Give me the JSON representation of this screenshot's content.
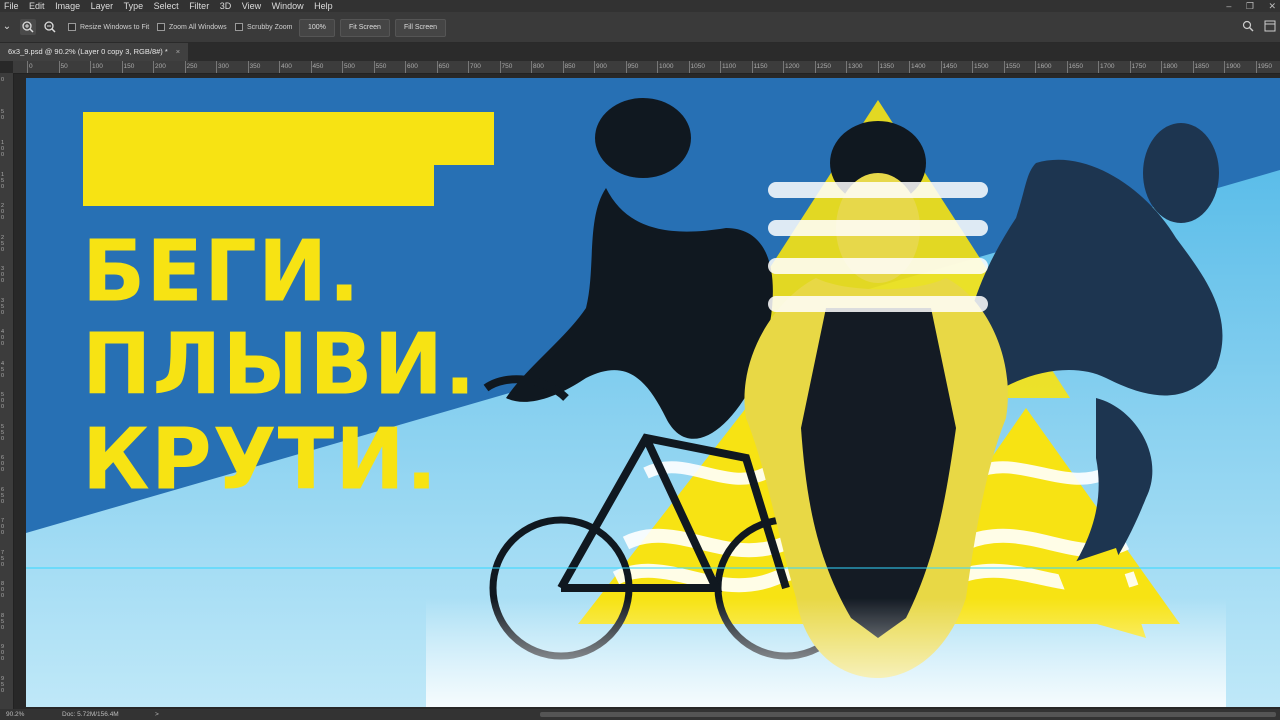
{
  "menu": [
    "File",
    "Edit",
    "Image",
    "Layer",
    "Type",
    "Select",
    "Filter",
    "3D",
    "View",
    "Window",
    "Help"
  ],
  "options": {
    "resize_windows": "Resize Windows to Fit",
    "zoom_all": "Zoom All Windows",
    "scrubby": "Scrubby Zoom",
    "zoom_value": "100%",
    "fit_screen": "Fit Screen",
    "fill_screen": "Fill Screen"
  },
  "tab": {
    "title": "6x3_9.psd @ 90.2% (Layer 0 copy 3, RGB/8#) *",
    "close": "×"
  },
  "ruler_top": [
    "0",
    "50",
    "100",
    "150",
    "200",
    "250",
    "300",
    "350",
    "400",
    "450",
    "500",
    "550",
    "600",
    "650",
    "700",
    "750",
    "800",
    "850",
    "900",
    "950",
    "1000",
    "1050",
    "1100",
    "1150",
    "1200",
    "1250",
    "1300",
    "1350",
    "1400",
    "1450",
    "1500",
    "1550",
    "1600",
    "1650",
    "1700",
    "1750",
    "1800",
    "1850",
    "1900",
    "1950"
  ],
  "ruler_left": [
    "0",
    "50",
    "100",
    "150",
    "200",
    "250",
    "300",
    "350",
    "400",
    "450",
    "500",
    "550",
    "600",
    "650",
    "700",
    "750",
    "800",
    "850",
    "900",
    "950"
  ],
  "artwork": {
    "line1": "БЕГИ.",
    "line2": "ПЛЫВИ.",
    "line3": "КРУТИ."
  },
  "colors": {
    "yellow": "#f7e313",
    "blue_dark": "#2770b4",
    "blue_light": "#6ec9ef",
    "guide": "#32d7ff"
  },
  "status": {
    "zoom": "90.2%",
    "doc": "Doc: 5.72M/156.4M",
    "arrow": ">"
  }
}
